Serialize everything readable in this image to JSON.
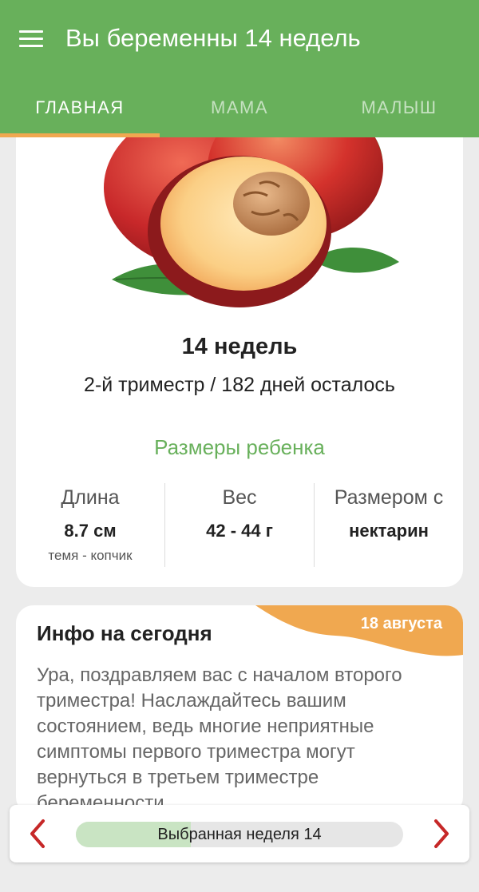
{
  "header": {
    "title": "Вы беременны 14 недель",
    "icon": "hamburger-menu-icon"
  },
  "tabs": [
    {
      "label": "ГЛАВНАЯ",
      "active": true
    },
    {
      "label": "МАМА",
      "active": false
    },
    {
      "label": "МАЛЫШ",
      "active": false
    }
  ],
  "main_card": {
    "image": "nectarine-illustration",
    "week_title": "14 недель",
    "trimester_line": "2-й триместр / 182 дней осталось",
    "sizes_title": "Размеры ребенка",
    "stats": [
      {
        "label": "Длина",
        "value": "8.7 см",
        "sub": "темя - копчик"
      },
      {
        "label": "Вес",
        "value": "42 - 44 г",
        "sub": ""
      },
      {
        "label": "Размером с",
        "value": "нектарин",
        "sub": ""
      }
    ]
  },
  "info_card": {
    "title": "Инфо на сегодня",
    "date": "18 августа",
    "text": "Ура, поздравляем вас с началом второго триместра! Наслаждайтесь вашим состоянием, ведь многие неприятные симптомы первого триместра могут вернуться в третьем триместре беременности."
  },
  "week_selector": {
    "label": "Выбранная неделя 14",
    "progress_fraction": 0.35,
    "prev_icon": "chevron-left-icon",
    "next_icon": "chevron-right-icon"
  },
  "colors": {
    "primary_green": "#68b05b",
    "accent_orange": "#f0a850",
    "nav_arrow_red": "#c62828",
    "progress_fill": "#c9e4c3"
  }
}
